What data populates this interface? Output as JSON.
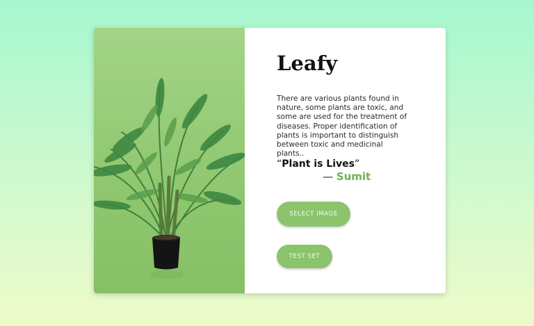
{
  "card": {
    "title": "Leafy",
    "description": "There are various plants found in nature, some plants are toxic, and some are used for the treatment of diseases. Proper identification of plants is important to distinguish between toxic and medicinal plants..",
    "quote_open": "“",
    "quote_text": "Plant is Lives",
    "quote_close": "”",
    "author_dash": "— ",
    "author_name": "Sumit"
  },
  "buttons": {
    "select_image": "SELECT IMAGE",
    "test_set": "TEST SET"
  },
  "colors": {
    "accent": "#8bc46c",
    "author": "#6fb24f",
    "panel": "#92c972"
  },
  "icons": {
    "plant": "potted-palm-illustration"
  }
}
